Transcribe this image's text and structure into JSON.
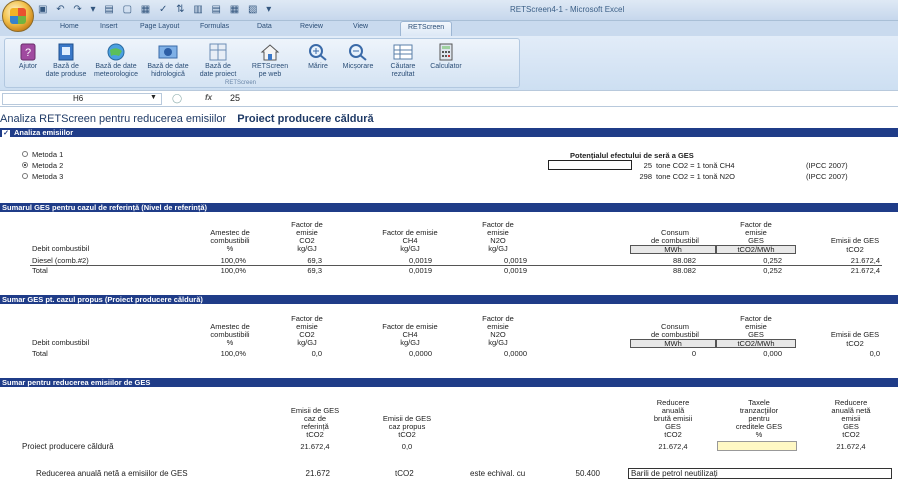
{
  "window": {
    "title": "RETScreen4-1 - Microsoft Excel"
  },
  "tabs": [
    "Home",
    "Insert",
    "Page Layout",
    "Formulas",
    "Data",
    "Review",
    "View",
    "RETScreen"
  ],
  "active_tab": "RETScreen",
  "ribbon": {
    "buttons": [
      {
        "line1": "Ajutor",
        "line2": ""
      },
      {
        "line1": "Bază de",
        "line2": "date produse"
      },
      {
        "line1": "Bază de date",
        "line2": "meteorologice"
      },
      {
        "line1": "Bază de date",
        "line2": "hidrologică"
      },
      {
        "line1": "Bază de",
        "line2": "date proiect"
      },
      {
        "line1": "RETScreen",
        "line2": "pe web"
      },
      {
        "line1": "Mărire",
        "line2": ""
      },
      {
        "line1": "Micșorare",
        "line2": ""
      },
      {
        "line1": "Căutare",
        "line2": "rezultat"
      },
      {
        "line1": "Calculator",
        "line2": ""
      }
    ],
    "group_name": "RETScreen"
  },
  "formula_bar": {
    "cell": "H6",
    "fx": "fx",
    "value": "25"
  },
  "sheet_title": {
    "a": "Analiza RETScreen pentru reducerea emisiilor",
    "b": "Proiect producere căldură"
  },
  "analysis": {
    "header": "Analiza emisiilor",
    "checkbox": "✓",
    "methods": [
      "Metoda 1",
      "Metoda 2",
      "Metoda 3"
    ],
    "selected_method": 1,
    "ghg_title": "Potențialul efectului de seră a GES",
    "ghg_lines": [
      {
        "value": "25",
        "text": "tone CO2 = 1 tonă CH4",
        "src": "(IPCC 2007)"
      },
      {
        "value": "298",
        "text": "tone CO2 = 1 tonă N2O",
        "src": "(IPCC 2007)"
      }
    ]
  },
  "base_case": {
    "header": "Sumarul GES pentru cazul de referință (Nivel de referință)",
    "col_headers": {
      "c0": "Debit combustibil",
      "c1": [
        "Amestec de",
        "combustibili",
        "%"
      ],
      "c2": [
        "Factor de",
        "emisie",
        "CO2",
        "kg/GJ"
      ],
      "c3": [
        "Factor de emisie",
        "CH4",
        "kg/GJ"
      ],
      "c4": [
        "Factor de",
        "emisie",
        "N2O",
        "kg/GJ"
      ],
      "c5": [
        "Consum",
        "de combustibil",
        "MWh"
      ],
      "c6": [
        "Factor de",
        "emisie",
        "GES",
        "tCO2/MWh"
      ],
      "c7": [
        "Emisii de GES",
        "tCO2"
      ]
    },
    "rows": [
      [
        "Diesel (comb.#2)",
        "100,0%",
        "69,3",
        "0,0019",
        "0,0019",
        "88.082",
        "0,252",
        "21.672,4"
      ],
      [
        "Total",
        "100,0%",
        "69,3",
        "0,0019",
        "0,0019",
        "88.082",
        "0,252",
        "21.672,4"
      ]
    ]
  },
  "proposed_case": {
    "header": "Sumar GES pt. cazul propus (Proiect producere căldură)",
    "col_headers": {
      "c0": "Debit combustibil",
      "c1": [
        "Amestec de",
        "combustibili",
        "%"
      ],
      "c2": [
        "Factor de",
        "emisie",
        "CO2",
        "kg/GJ"
      ],
      "c3": [
        "Factor de emisie",
        "CH4",
        "kg/GJ"
      ],
      "c4": [
        "Factor de",
        "emisie",
        "N2O",
        "kg/GJ"
      ],
      "c5": [
        "Consum",
        "de combustibil",
        "MWh"
      ],
      "c6": [
        "Factor de",
        "emisie",
        "GES",
        "tCO2/MWh"
      ],
      "c7": [
        "Emisii de GES",
        "tCO2"
      ]
    },
    "rows": [
      [
        "Total",
        "100,0%",
        "0,0",
        "0,0000",
        "0,0000",
        "0",
        "0,000",
        "0,0"
      ]
    ]
  },
  "reduction": {
    "header": "Sumar pentru reducerea emisiilor de GES",
    "col_headers": {
      "a": [
        "Emisii de GES",
        "caz de",
        "referință",
        "tCO2"
      ],
      "b": [
        "Emisii de GES",
        "caz propus",
        "tCO2"
      ],
      "c": [
        "Reducere",
        "anuală",
        "brută emisii",
        "GES",
        "tCO2"
      ],
      "d": [
        "Taxele",
        "tranzacţiilor",
        "pentru",
        "creditele GES",
        "%"
      ],
      "e": [
        "Reducere",
        "anuală netă",
        "emisii",
        "GES",
        "tCO2"
      ]
    },
    "row": {
      "label": "Proiect producere căldură",
      "a": "21.672,4",
      "b": "0,0",
      "c": "21.672,4",
      "d": "",
      "e": "21.672,4"
    },
    "net": {
      "label": "Reducerea anuală netă a emisiilor de GES",
      "value": "21.672",
      "unit": "tCO2",
      "equiv": "este echival. cu",
      "equiv_value": "50.400",
      "equiv_item": "Barili de petrol neutilizați"
    }
  }
}
